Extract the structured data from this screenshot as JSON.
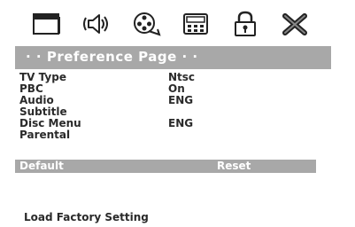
{
  "tabs": [
    {
      "icon": "monitor-icon"
    },
    {
      "icon": "speaker-icon"
    },
    {
      "icon": "film-reel-icon"
    },
    {
      "icon": "keypad-icon"
    },
    {
      "icon": "lock-icon"
    },
    {
      "icon": "exit-x-icon"
    }
  ],
  "header": {
    "title": "· · Preference Page · ·"
  },
  "menu": {
    "items": [
      {
        "label": "TV Type",
        "value": "Ntsc"
      },
      {
        "label": "PBC",
        "value": "On"
      },
      {
        "label": "Audio",
        "value": "ENG"
      },
      {
        "label": "Subtitle",
        "value": ""
      },
      {
        "label": "Disc Menu",
        "value": "ENG"
      },
      {
        "label": "Parental",
        "value": ""
      }
    ],
    "selected": {
      "label": "Default",
      "option": "Reset"
    }
  },
  "footer": {
    "help_text": "Load Factory Setting"
  },
  "colors": {
    "highlight": "#a8a8a8",
    "text": "#2a2a2a",
    "background": "#ffffff"
  }
}
